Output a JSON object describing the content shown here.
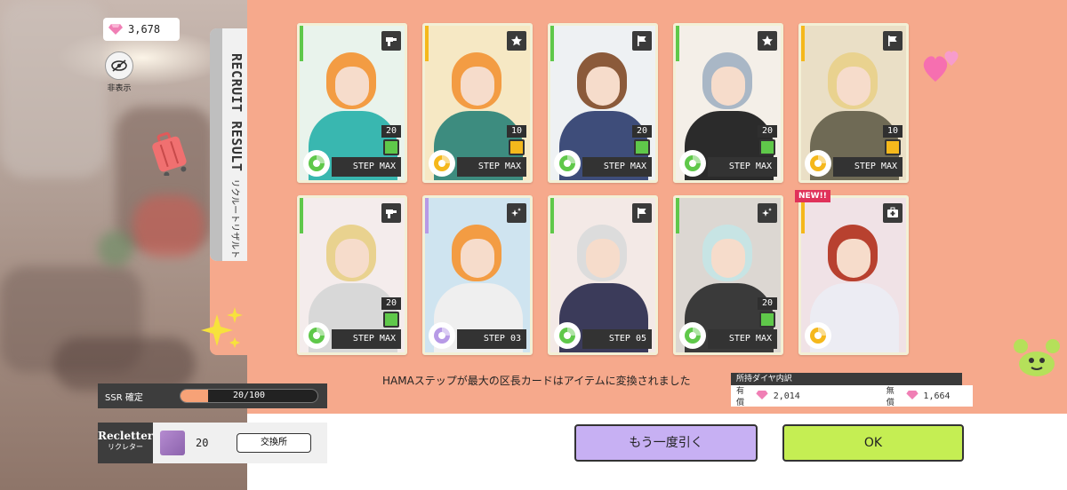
{
  "currency": {
    "amount": "3,678"
  },
  "hide": {
    "label": "非表示"
  },
  "side_tab": {
    "title_en": "RECRUIT RESULT",
    "title_jp": "リクルートリザルト"
  },
  "cards": [
    {
      "count": "20",
      "step": "STEP MAX",
      "attr": "green",
      "type": "drill",
      "hair": "#f39c43",
      "body": "#39b7b0",
      "bg": "#e9f3ec"
    },
    {
      "count": "10",
      "step": "STEP MAX",
      "attr": "yellow",
      "type": "star",
      "hair": "#f39c43",
      "body": "#3d8c7f",
      "bg": "#f6e8c4"
    },
    {
      "count": "20",
      "step": "STEP MAX",
      "attr": "green",
      "type": "flag",
      "hair": "#8b5a3a",
      "body": "#3e4d7a",
      "bg": "#eef1f3"
    },
    {
      "count": "20",
      "step": "STEP MAX",
      "attr": "green",
      "type": "star",
      "hair": "#a9b7c6",
      "body": "#2b2b2b",
      "bg": "#f4efe8"
    },
    {
      "count": "10",
      "step": "STEP MAX",
      "attr": "yellow",
      "type": "flag",
      "hair": "#e9d28f",
      "body": "#6f6a55",
      "bg": "#eadfc6"
    },
    {
      "count": "20",
      "step": "STEP MAX",
      "attr": "green",
      "type": "drill",
      "hair": "#e9d28f",
      "body": "#d8d8d8",
      "bg": "#f4ecec"
    },
    {
      "count": "",
      "step": "STEP 03",
      "attr": "purple",
      "type": "sparkle",
      "hair": "#f39c43",
      "body": "#efefef",
      "bg": "#cfe4f0"
    },
    {
      "count": "",
      "step": "STEP 05",
      "attr": "green",
      "type": "flag",
      "hair": "#dcdcdc",
      "body": "#3b3b5a",
      "bg": "#f3e9e6"
    },
    {
      "count": "20",
      "step": "STEP MAX",
      "attr": "green",
      "type": "sparkle",
      "hair": "#c7e4e4",
      "body": "#3a3a3a",
      "bg": "#dcd7d2"
    },
    {
      "count": "",
      "step": "",
      "attr": "yellow",
      "type": "medic",
      "hair": "#b8412f",
      "body": "#ececf3",
      "bg": "#f0e2e6",
      "badge": "NEW!!"
    }
  ],
  "message": "HAMAステップが最大の区長カードはアイテムに変換されました",
  "breakdown": {
    "title": "所持ダイヤ内訳",
    "paid_label": "有償",
    "paid_value": "2,014",
    "free_label": "無償",
    "free_value": "1,664"
  },
  "ssr": {
    "label": "SSR 確定",
    "progress_text": "20/100",
    "progress_fraction": 0.2
  },
  "recletter": {
    "title_en": "Recletter",
    "title_jp": "リクレター",
    "count": "20",
    "exchange_label": "交換所"
  },
  "buttons": {
    "again": "もう一度引く",
    "ok": "OK"
  },
  "colors": {
    "panel": "#f6a98c",
    "again_btn": "#c7b0f3",
    "ok_btn": "#c5ee53",
    "attr_green": "#5fc84a",
    "attr_yellow": "#f5b81c",
    "attr_purple": "#b79ae6"
  }
}
